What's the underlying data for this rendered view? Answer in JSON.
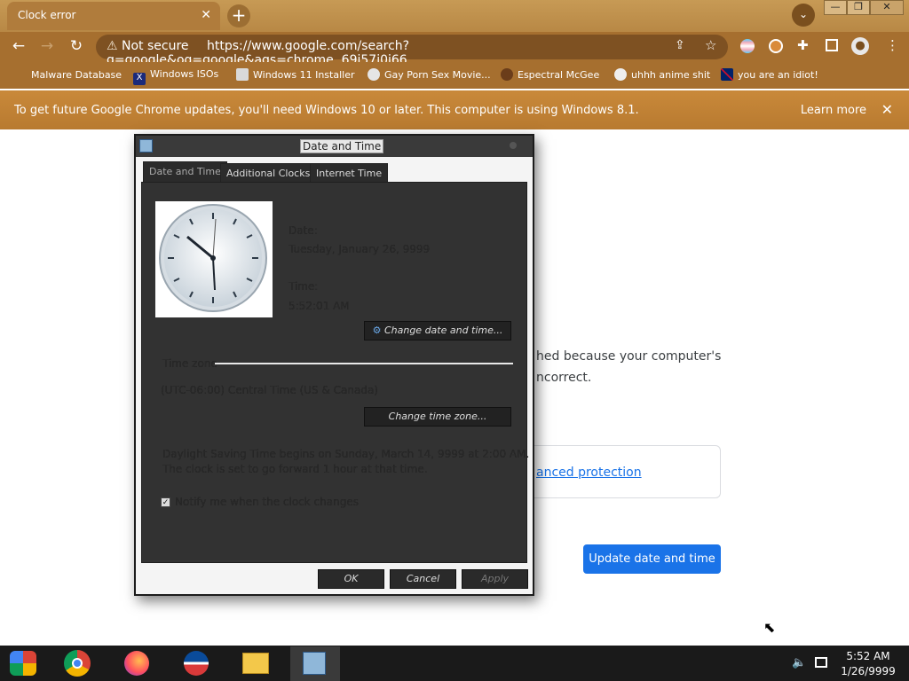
{
  "browser": {
    "tab_title": "Clock error",
    "tab_close": "✕",
    "new_tab": "+",
    "window_controls": [
      "—",
      "❐",
      "✕"
    ],
    "not_secure": "Not secure",
    "url": "https://www.google.com/search?q=google&oq=google&aqs=chrome..69i57j0i66...",
    "bookmarks": [
      "Malware Database",
      "Windows ISOs",
      "Windows 11 Installer",
      "Gay Porn Sex Movie...",
      "Espectral McGee",
      "uhhh anime shit",
      "you are an idiot!"
    ],
    "infobar": {
      "text": "To get future Google Chrome updates, you'll need Windows 10 or later. This computer is using Windows 8.1.",
      "learn_more": "Learn more",
      "close": "✕"
    }
  },
  "page": {
    "text_line1": "hed because your computer's",
    "text_line2": "ncorrect.",
    "protection_link": "anced protection",
    "update_button": "Update date and time"
  },
  "dialog": {
    "title": "Date and Time",
    "tabs": [
      "Date and Time",
      "Additional Clocks",
      "Internet Time"
    ],
    "date_label": "Date:",
    "date_value": "Tuesday, January 26, 9999",
    "time_label": "Time:",
    "time_value": "5:52:01 AM",
    "change_datetime_button": "Change date and time...",
    "timezone_label": "Time zone",
    "timezone_value": "(UTC-06:00) Central Time (US & Canada)",
    "change_timezone_button": "Change time zone...",
    "dst_line1": "Daylight Saving Time begins on Sunday, March 14, 9999 at 2:00 AM.",
    "dst_line2": "The clock is set to go forward 1 hour at that time.",
    "notify_label": "Notify me when the clock changes",
    "ok": "OK",
    "cancel": "Cancel",
    "apply": "Apply"
  },
  "taskbar": {
    "time": "5:52 AM",
    "date": "1/26/9999"
  },
  "colors": {
    "chrome_theme": "#a66f2f",
    "button_blue": "#1a73e8",
    "dialog_dark": "#323232"
  }
}
